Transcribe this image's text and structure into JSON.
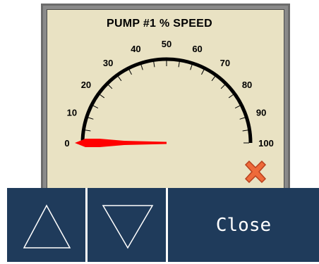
{
  "gauge": {
    "title": "PUMP #1 % SPEED",
    "min": 0,
    "max": 100,
    "value": 0,
    "tick_labels": [
      "0",
      "10",
      "20",
      "30",
      "40",
      "50",
      "60",
      "70",
      "80",
      "90",
      "100"
    ],
    "needle_color": "#ff0000",
    "arc_color": "#000000",
    "panel_color": "#e9e2c3"
  },
  "status_icon": "red-x-icon",
  "controls": {
    "up_icon": "triangle-up-icon",
    "down_icon": "triangle-down-icon",
    "close_label": "Close",
    "button_color": "#1f3b5b"
  }
}
